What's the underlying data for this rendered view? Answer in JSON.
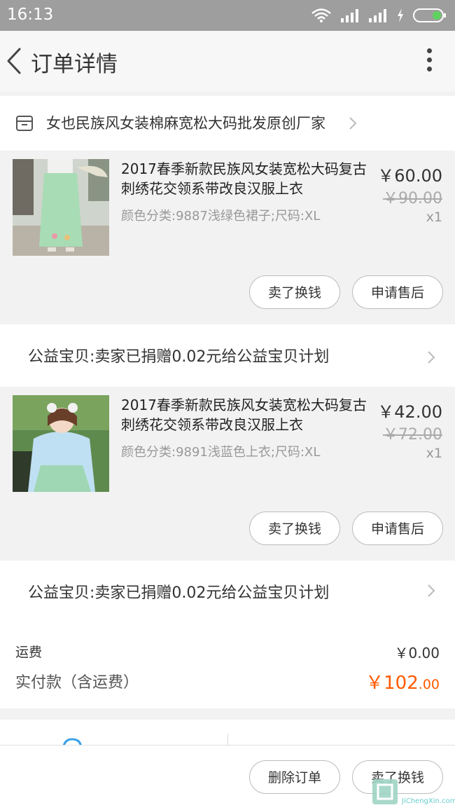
{
  "status_bar": {
    "time": "16:13",
    "icons": [
      "wifi-icon",
      "signal-icon",
      "signal-icon",
      "charging-icon",
      "battery-icon"
    ]
  },
  "header": {
    "title": "订单详情",
    "back_icon": "chevron-left-icon",
    "more_icon": "more-vertical-icon"
  },
  "shop": {
    "name": "女也民族风女装棉麻宽松大码批发原创厂家",
    "icon": "store-icon"
  },
  "items": [
    {
      "name": "2017春季新款民族风女装宽松大码复古刺绣花交领系带改良汉服上衣",
      "spec": "颜色分类:9887浅绿色裙子;尺码:XL",
      "price": "￥60.00",
      "original_price": "￥90.00",
      "quantity": "x1",
      "buttons": [
        "卖了换钱",
        "申请售后"
      ],
      "charity": "公益宝贝:卖家已捐赠0.02元给公益宝贝计划"
    },
    {
      "name": "2017春季新款民族风女装宽松大码复古刺绣花交领系带改良汉服上衣",
      "spec": "颜色分类:9891浅蓝色上衣;尺码:XL",
      "price": "￥42.00",
      "original_price": "￥72.00",
      "quantity": "x1",
      "buttons": [
        "卖了换钱",
        "申请售后"
      ],
      "charity": "公益宝贝:卖家已捐赠0.02元给公益宝贝计划"
    }
  ],
  "summary": {
    "shipping_label": "运费",
    "shipping_value": "￥0.00",
    "paid_label": "实付款（含运费）",
    "paid_value_main": "￥102",
    "paid_value_cents": ".00"
  },
  "bottom_bar": {
    "delete_button": "删除订单",
    "sell_button": "卖了换钱"
  },
  "watermark": {
    "text": "JiChengXin.com"
  },
  "colors": {
    "accent": "#ff5a00",
    "status_bar": "#9e9e9e",
    "background": "#f2f2f2"
  }
}
